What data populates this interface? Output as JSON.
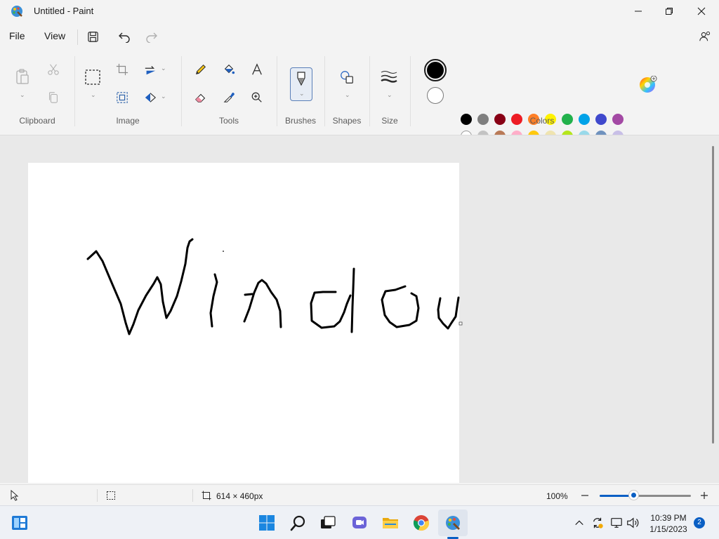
{
  "window": {
    "title": "Untitled - Paint"
  },
  "menu": {
    "file": "File",
    "view": "View"
  },
  "ribbon": {
    "groups": {
      "clipboard": "Clipboard",
      "image": "Image",
      "tools": "Tools",
      "brushes": "Brushes",
      "shapes": "Shapes",
      "size": "Size",
      "colors": "Colors"
    }
  },
  "colors": {
    "primary": "#000000",
    "secondary": "#ffffff",
    "palette_row1": [
      "#000000",
      "#7f7f7f",
      "#880015",
      "#ed1c24",
      "#ff7f27",
      "#fff200",
      "#22b14c",
      "#00a2e8",
      "#3f48cc",
      "#a349a4"
    ],
    "palette_row2": [
      "#ffffff",
      "#c3c3c3",
      "#b97a57",
      "#ffaec9",
      "#ffc90e",
      "#efe4b0",
      "#b5e61d",
      "#99d9ea",
      "#7092be",
      "#c8bfe7"
    ],
    "palette_row3_empty": 10
  },
  "status": {
    "canvas_size": "614 × 460px",
    "zoom": "100%",
    "zoom_level_fraction": 0.38
  },
  "taskbar": {
    "time": "10:39 PM",
    "date": "1/15/2023",
    "notifications": "2"
  }
}
